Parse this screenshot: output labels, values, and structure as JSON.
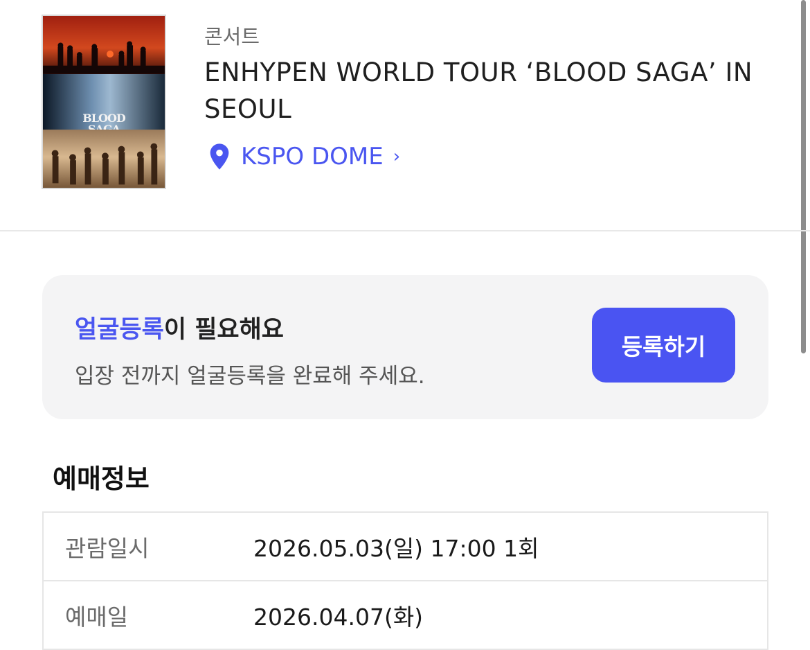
{
  "event": {
    "category": "콘서트",
    "title": "ENHYPEN WORLD TOUR ‘BLOOD SAGA’ IN SEOUL",
    "venue": "KSPO DOME",
    "venue_chevron": "›",
    "poster_logo_line1": "BLOOD",
    "poster_logo_line2": "SAGA"
  },
  "face_registration": {
    "title_accent": "얼굴등록",
    "title_rest": "이 필요해요",
    "description": "입장 전까지 얼굴등록을 완료해 주세요.",
    "button_label": "등록하기"
  },
  "booking_info": {
    "section_title": "예매정보",
    "rows": [
      {
        "label": "관람일시",
        "value": "2026.05.03(일) 17:00 1회"
      },
      {
        "label": "예매일",
        "value": "2026.04.07(화)"
      }
    ]
  },
  "colors": {
    "accent": "#4a56f0",
    "button": "#4a54f2",
    "card_bg": "#f4f4f5"
  },
  "icons": {
    "venue": "location-pin-icon",
    "venue_link": "chevron-right-icon"
  }
}
